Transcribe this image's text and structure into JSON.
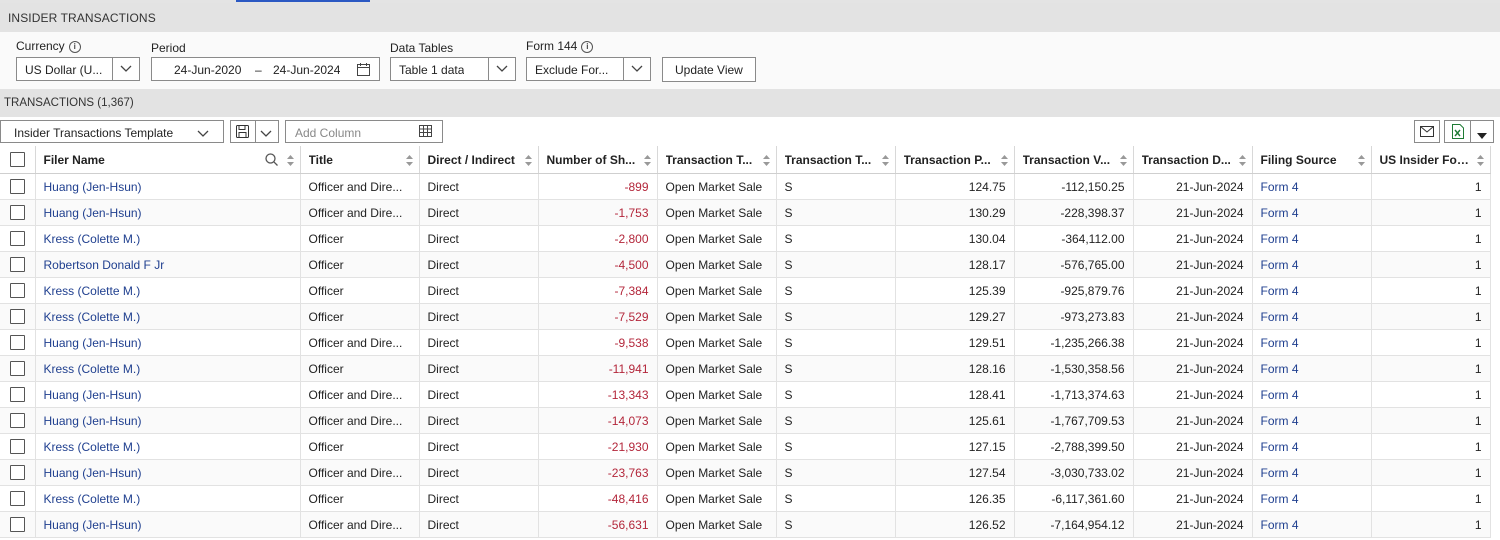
{
  "header": {
    "title": "INSIDER TRANSACTIONS"
  },
  "filters": {
    "currency": {
      "label": "Currency",
      "value": "US Dollar (U...",
      "info_icon": "info-icon"
    },
    "period": {
      "label": "Period",
      "start": "24-Jun-2020",
      "separator": "–",
      "end": "24-Jun-2024",
      "calendar_icon": "calendar-icon"
    },
    "data_tables": {
      "label": "Data Tables",
      "value": "Table 1 data"
    },
    "form144": {
      "label": "Form 144",
      "value": "Exclude For...",
      "info_icon": "info-icon"
    },
    "update_button": "Update View"
  },
  "transactions": {
    "title": "TRANSACTIONS (1,367)",
    "template": "Insider Transactions Template",
    "add_column_placeholder": "Add Column",
    "columns": [
      "Filer Name",
      "Title",
      "Direct / Indirect",
      "Number of Sh...",
      "Transaction T...",
      "Transaction T...",
      "Transaction P...",
      "Transaction V...",
      "Transaction D...",
      "Filing Source",
      "US Insider For..."
    ],
    "rows": [
      {
        "name": "Huang (Jen-Hsun)",
        "title": "Officer and Dire...",
        "direct": "Direct",
        "shares": "-899",
        "type": "Open Market Sale",
        "code": "S",
        "price": "124.75",
        "value": "-112,150.25",
        "date": "21-Jun-2024",
        "source": "Form 4",
        "form": "1"
      },
      {
        "name": "Huang (Jen-Hsun)",
        "title": "Officer and Dire...",
        "direct": "Direct",
        "shares": "-1,753",
        "type": "Open Market Sale",
        "code": "S",
        "price": "130.29",
        "value": "-228,398.37",
        "date": "21-Jun-2024",
        "source": "Form 4",
        "form": "1"
      },
      {
        "name": "Kress (Colette M.)",
        "title": "Officer",
        "direct": "Direct",
        "shares": "-2,800",
        "type": "Open Market Sale",
        "code": "S",
        "price": "130.04",
        "value": "-364,112.00",
        "date": "21-Jun-2024",
        "source": "Form 4",
        "form": "1"
      },
      {
        "name": "Robertson Donald F Jr",
        "title": "Officer",
        "direct": "Direct",
        "shares": "-4,500",
        "type": "Open Market Sale",
        "code": "S",
        "price": "128.17",
        "value": "-576,765.00",
        "date": "21-Jun-2024",
        "source": "Form 4",
        "form": "1"
      },
      {
        "name": "Kress (Colette M.)",
        "title": "Officer",
        "direct": "Direct",
        "shares": "-7,384",
        "type": "Open Market Sale",
        "code": "S",
        "price": "125.39",
        "value": "-925,879.76",
        "date": "21-Jun-2024",
        "source": "Form 4",
        "form": "1"
      },
      {
        "name": "Kress (Colette M.)",
        "title": "Officer",
        "direct": "Direct",
        "shares": "-7,529",
        "type": "Open Market Sale",
        "code": "S",
        "price": "129.27",
        "value": "-973,273.83",
        "date": "21-Jun-2024",
        "source": "Form 4",
        "form": "1"
      },
      {
        "name": "Huang (Jen-Hsun)",
        "title": "Officer and Dire...",
        "direct": "Direct",
        "shares": "-9,538",
        "type": "Open Market Sale",
        "code": "S",
        "price": "129.51",
        "value": "-1,235,266.38",
        "date": "21-Jun-2024",
        "source": "Form 4",
        "form": "1"
      },
      {
        "name": "Kress (Colette M.)",
        "title": "Officer",
        "direct": "Direct",
        "shares": "-11,941",
        "type": "Open Market Sale",
        "code": "S",
        "price": "128.16",
        "value": "-1,530,358.56",
        "date": "21-Jun-2024",
        "source": "Form 4",
        "form": "1"
      },
      {
        "name": "Huang (Jen-Hsun)",
        "title": "Officer and Dire...",
        "direct": "Direct",
        "shares": "-13,343",
        "type": "Open Market Sale",
        "code": "S",
        "price": "128.41",
        "value": "-1,713,374.63",
        "date": "21-Jun-2024",
        "source": "Form 4",
        "form": "1"
      },
      {
        "name": "Huang (Jen-Hsun)",
        "title": "Officer and Dire...",
        "direct": "Direct",
        "shares": "-14,073",
        "type": "Open Market Sale",
        "code": "S",
        "price": "125.61",
        "value": "-1,767,709.53",
        "date": "21-Jun-2024",
        "source": "Form 4",
        "form": "1"
      },
      {
        "name": "Kress (Colette M.)",
        "title": "Officer",
        "direct": "Direct",
        "shares": "-21,930",
        "type": "Open Market Sale",
        "code": "S",
        "price": "127.15",
        "value": "-2,788,399.50",
        "date": "21-Jun-2024",
        "source": "Form 4",
        "form": "1"
      },
      {
        "name": "Huang (Jen-Hsun)",
        "title": "Officer and Dire...",
        "direct": "Direct",
        "shares": "-23,763",
        "type": "Open Market Sale",
        "code": "S",
        "price": "127.54",
        "value": "-3,030,733.02",
        "date": "21-Jun-2024",
        "source": "Form 4",
        "form": "1"
      },
      {
        "name": "Kress (Colette M.)",
        "title": "Officer",
        "direct": "Direct",
        "shares": "-48,416",
        "type": "Open Market Sale",
        "code": "S",
        "price": "126.35",
        "value": "-6,117,361.60",
        "date": "21-Jun-2024",
        "source": "Form 4",
        "form": "1"
      },
      {
        "name": "Huang (Jen-Hsun)",
        "title": "Officer and Dire...",
        "direct": "Direct",
        "shares": "-56,631",
        "type": "Open Market Sale",
        "code": "S",
        "price": "126.52",
        "value": "-7,164,954.12",
        "date": "21-Jun-2024",
        "source": "Form 4",
        "form": "1"
      }
    ]
  },
  "colors": {
    "link": "#1f3f8f",
    "negative": "#b3263a",
    "header_bg": "#e3e3e3",
    "excel_green": "#1e7b34"
  }
}
